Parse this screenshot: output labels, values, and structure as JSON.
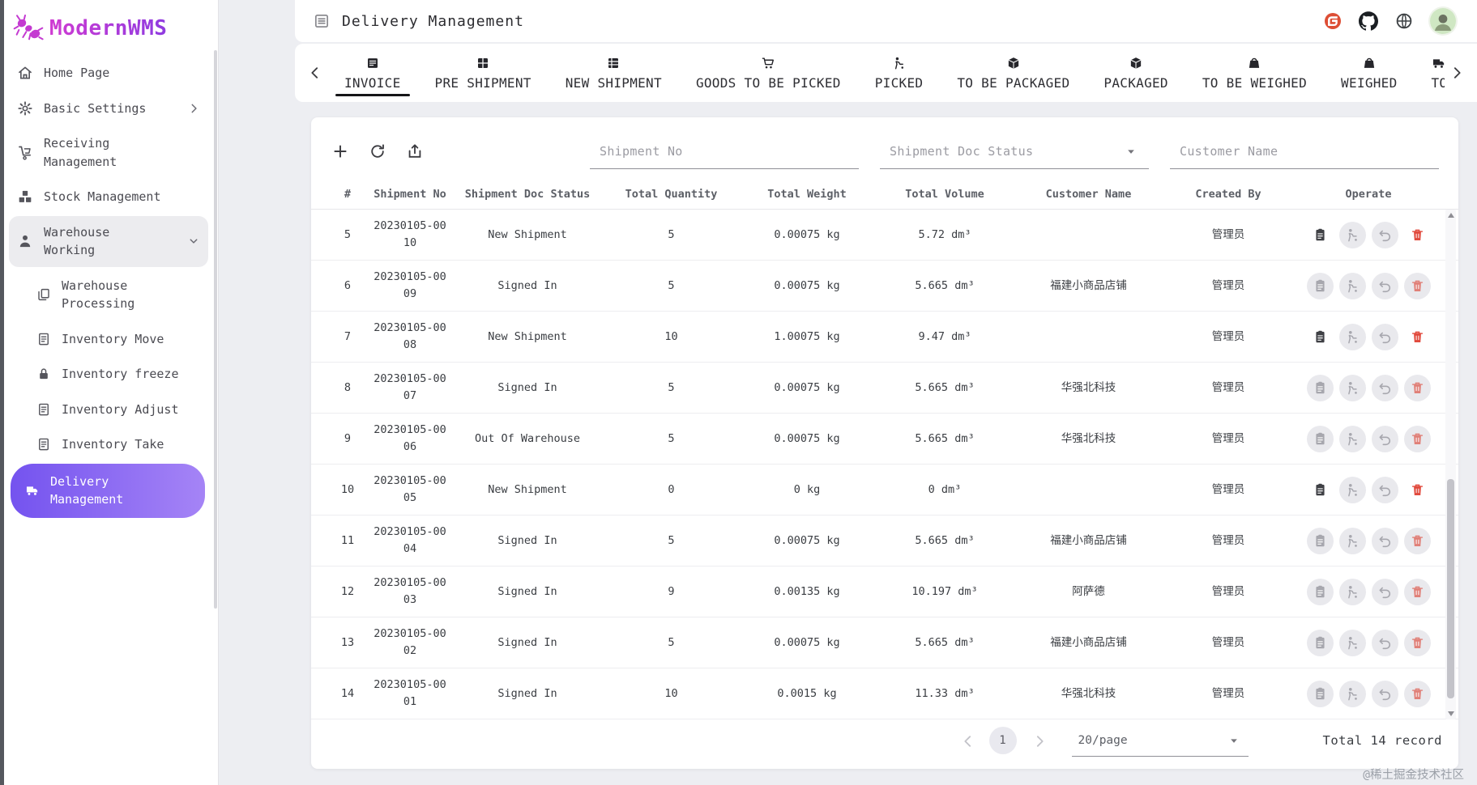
{
  "app": {
    "name": "ModernWMS",
    "logo_icon": "ant"
  },
  "colors": {
    "accent_start": "#7453ef",
    "accent_end": "#a584f6",
    "logo_start": "#cf3bd2",
    "logo_end": "#8f3be0",
    "danger": "#e14a3d"
  },
  "header": {
    "title": "Delivery Management",
    "icon": "list",
    "actions": [
      {
        "name": "gitee",
        "icon": "gitee"
      },
      {
        "name": "github",
        "icon": "github"
      },
      {
        "name": "globe",
        "icon": "globe"
      },
      {
        "name": "avatar",
        "icon": "avatar"
      }
    ]
  },
  "sidebar": {
    "items": [
      {
        "label": "Home Page",
        "icon": "home"
      },
      {
        "label": "Basic Settings",
        "icon": "gear",
        "chevron": "right"
      },
      {
        "label": "Receiving Management",
        "icon": "dolly"
      },
      {
        "label": "Stock Management",
        "icon": "boxes"
      },
      {
        "label": "Warehouse Working",
        "icon": "person",
        "chevron": "down",
        "expanded": true
      },
      {
        "label": "Warehouse Processing",
        "icon": "copy",
        "child": true
      },
      {
        "label": "Inventory Move",
        "icon": "doc",
        "child": true
      },
      {
        "label": "Inventory freeze",
        "icon": "lock",
        "child": true
      },
      {
        "label": "Inventory Adjust",
        "icon": "doc",
        "child": true
      },
      {
        "label": "Inventory Take",
        "icon": "doc",
        "child": true
      },
      {
        "label": "Delivery Management",
        "icon": "truck",
        "child": true,
        "active": true
      }
    ]
  },
  "tabs": [
    {
      "label": "INVOICE",
      "icon": "invoice",
      "active": true
    },
    {
      "label": "PRE SHIPMENT",
      "icon": "grid"
    },
    {
      "label": "NEW SHIPMENT",
      "icon": "grid2"
    },
    {
      "label": "GOODS TO BE PICKED",
      "icon": "cart"
    },
    {
      "label": "PICKED",
      "icon": "picker"
    },
    {
      "label": "TO BE PACKAGED",
      "icon": "package"
    },
    {
      "label": "PACKAGED",
      "icon": "package"
    },
    {
      "label": "TO BE WEIGHED",
      "icon": "weight"
    },
    {
      "label": "WEIGHED",
      "icon": "weight"
    },
    {
      "label": "TO",
      "icon": "truck",
      "truncated": true
    }
  ],
  "toolbar": {
    "buttons": [
      {
        "name": "add",
        "icon": "plus"
      },
      {
        "name": "refresh",
        "icon": "refresh"
      },
      {
        "name": "export",
        "icon": "export"
      }
    ]
  },
  "filters": [
    {
      "type": "text",
      "placeholder": "Shipment No",
      "value": ""
    },
    {
      "type": "select",
      "placeholder": "Shipment Doc Status",
      "value": ""
    },
    {
      "type": "text",
      "placeholder": "Customer Name",
      "value": ""
    }
  ],
  "table": {
    "columns": [
      "#",
      "Shipment No",
      "Shipment Doc Status",
      "Total Quantity",
      "Total Weight",
      "Total Volume",
      "Customer Name",
      "Created By",
      "Operate"
    ],
    "row_actions": [
      {
        "name": "task-assign",
        "icon": "clipboard"
      },
      {
        "name": "picking",
        "icon": "picker"
      },
      {
        "name": "undo",
        "icon": "undo"
      },
      {
        "name": "delete",
        "icon": "trash"
      }
    ],
    "rows": [
      {
        "index": 5,
        "shipment_no": "20230105-0010",
        "status": "New Shipment",
        "total_quantity": "5",
        "total_weight": "0.00075 kg",
        "total_volume": "5.72 dm³",
        "customer_name": "",
        "created_by": "管理员",
        "assign_enabled": true
      },
      {
        "index": 6,
        "shipment_no": "20230105-0009",
        "status": "Signed In",
        "total_quantity": "5",
        "total_weight": "0.00075 kg",
        "total_volume": "5.665 dm³",
        "customer_name": "福建小商品店铺",
        "created_by": "管理员",
        "assign_enabled": false
      },
      {
        "index": 7,
        "shipment_no": "20230105-0008",
        "status": "New Shipment",
        "total_quantity": "10",
        "total_weight": "1.00075 kg",
        "total_volume": "9.47 dm³",
        "customer_name": "",
        "created_by": "管理员",
        "assign_enabled": true
      },
      {
        "index": 8,
        "shipment_no": "20230105-0007",
        "status": "Signed In",
        "total_quantity": "5",
        "total_weight": "0.00075 kg",
        "total_volume": "5.665 dm³",
        "customer_name": "华强北科技",
        "created_by": "管理员",
        "assign_enabled": false
      },
      {
        "index": 9,
        "shipment_no": "20230105-0006",
        "status": "Out Of Warehouse",
        "total_quantity": "5",
        "total_weight": "0.00075 kg",
        "total_volume": "5.665 dm³",
        "customer_name": "华强北科技",
        "created_by": "管理员",
        "assign_enabled": false
      },
      {
        "index": 10,
        "shipment_no": "20230105-0005",
        "status": "New Shipment",
        "total_quantity": "0",
        "total_weight": "0 kg",
        "total_volume": "0 dm³",
        "customer_name": "",
        "created_by": "管理员",
        "assign_enabled": true
      },
      {
        "index": 11,
        "shipment_no": "20230105-0004",
        "status": "Signed In",
        "total_quantity": "5",
        "total_weight": "0.00075 kg",
        "total_volume": "5.665 dm³",
        "customer_name": "福建小商品店铺",
        "created_by": "管理员",
        "assign_enabled": false
      },
      {
        "index": 12,
        "shipment_no": "20230105-0003",
        "status": "Signed In",
        "total_quantity": "9",
        "total_weight": "0.00135 kg",
        "total_volume": "10.197 dm³",
        "customer_name": "阿萨德",
        "created_by": "管理员",
        "assign_enabled": false
      },
      {
        "index": 13,
        "shipment_no": "20230105-0002",
        "status": "Signed In",
        "total_quantity": "5",
        "total_weight": "0.00075 kg",
        "total_volume": "5.665 dm³",
        "customer_name": "福建小商品店铺",
        "created_by": "管理员",
        "assign_enabled": false
      },
      {
        "index": 14,
        "shipment_no": "20230105-0001",
        "status": "Signed In",
        "total_quantity": "10",
        "total_weight": "0.0015 kg",
        "total_volume": "11.33 dm³",
        "customer_name": "华强北科技",
        "created_by": "管理员",
        "assign_enabled": false
      }
    ]
  },
  "pagination": {
    "page": "1",
    "page_size": "20/page"
  },
  "summary": {
    "total_text": "Total 14 record",
    "watermark": "@稀土掘金技术社区"
  }
}
